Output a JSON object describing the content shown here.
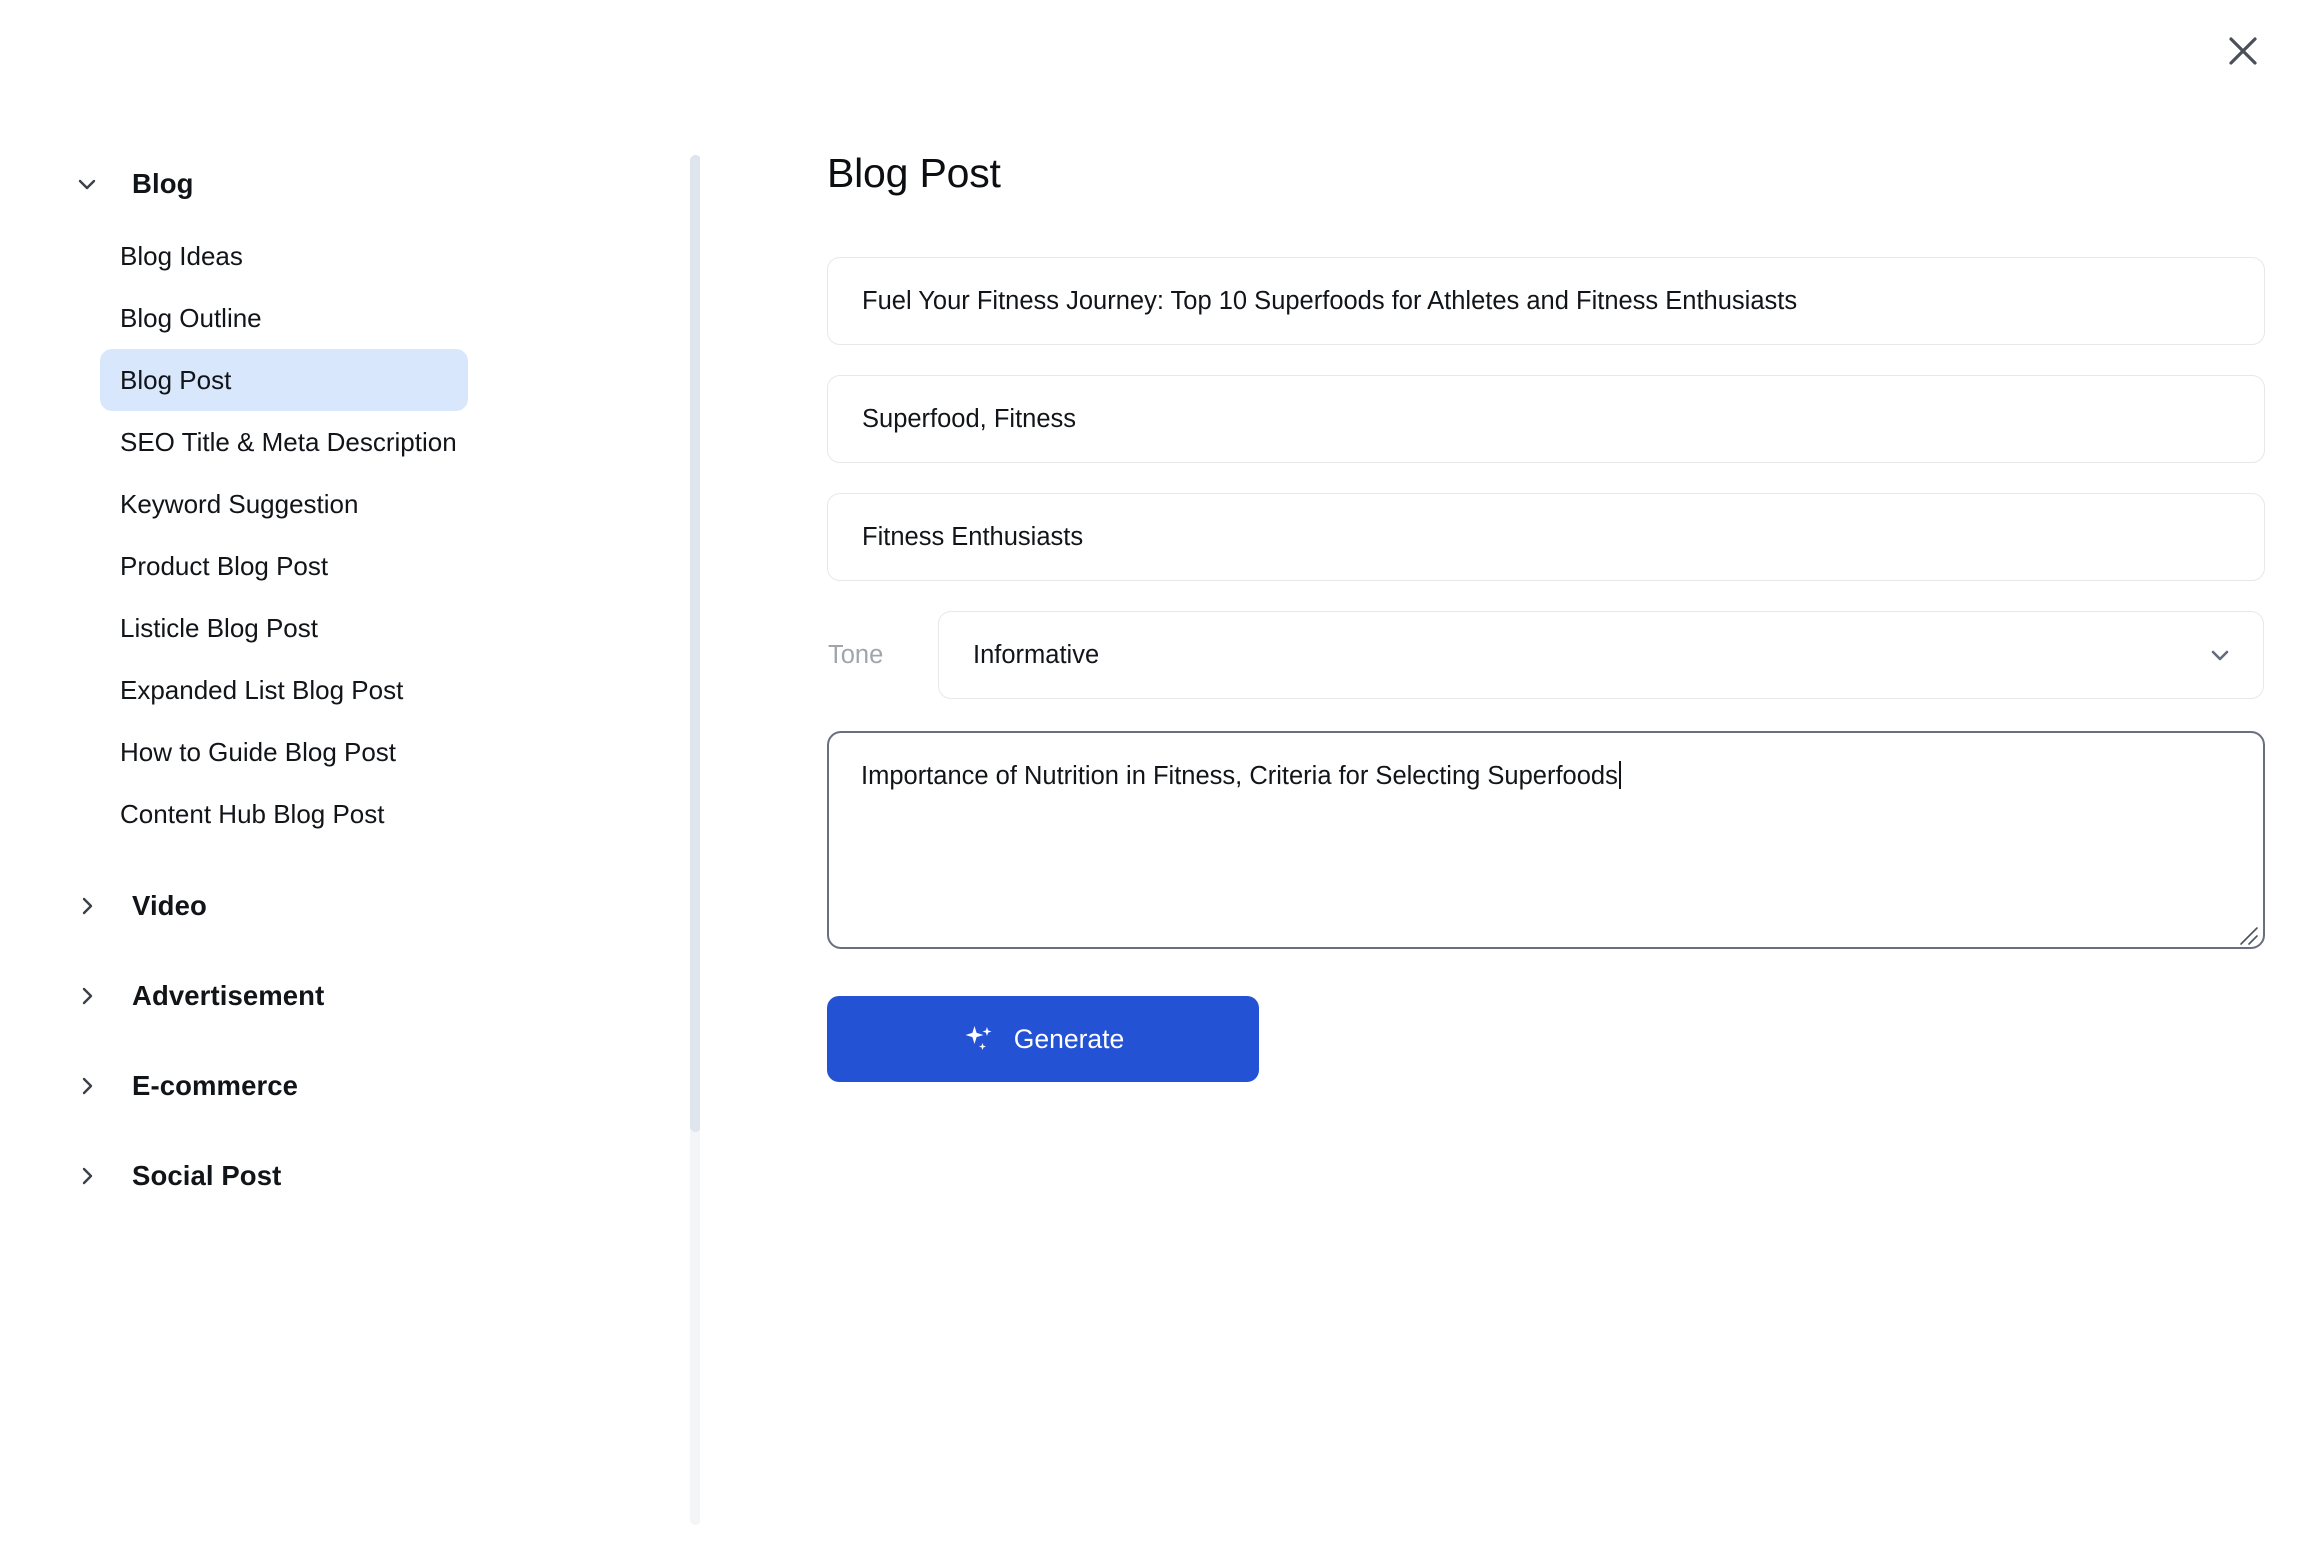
{
  "window": {
    "close_label": "Close"
  },
  "sidebar": {
    "groups": [
      {
        "label": "Blog",
        "expanded": true,
        "icon": "chevron-down-icon",
        "items": [
          {
            "label": "Blog Ideas",
            "selected": false
          },
          {
            "label": "Blog Outline",
            "selected": false
          },
          {
            "label": "Blog Post",
            "selected": true
          },
          {
            "label": "SEO Title & Meta Description",
            "selected": false
          },
          {
            "label": "Keyword Suggestion",
            "selected": false
          },
          {
            "label": "Product Blog Post",
            "selected": false
          },
          {
            "label": "Listicle Blog Post",
            "selected": false
          },
          {
            "label": "Expanded List Blog Post",
            "selected": false
          },
          {
            "label": "How to Guide Blog Post",
            "selected": false
          },
          {
            "label": "Content Hub Blog Post",
            "selected": false
          }
        ]
      },
      {
        "label": "Video",
        "expanded": false,
        "icon": "chevron-right-icon",
        "items": []
      },
      {
        "label": "Advertisement",
        "expanded": false,
        "icon": "chevron-right-icon",
        "items": []
      },
      {
        "label": "E-commerce",
        "expanded": false,
        "icon": "chevron-right-icon",
        "items": []
      },
      {
        "label": "Social Post",
        "expanded": false,
        "icon": "chevron-right-icon",
        "items": []
      }
    ]
  },
  "main": {
    "title": "Blog Post",
    "fields": {
      "topic": {
        "value": "Fuel Your Fitness Journey: Top 10 Superfoods for Athletes and Fitness Enthusiasts",
        "placeholder": "Blog title"
      },
      "keywords": {
        "value": "Superfood, Fitness",
        "placeholder": "Keywords"
      },
      "audience": {
        "value": "Fitness Enthusiasts",
        "placeholder": "Target audience"
      },
      "tone": {
        "label": "Tone",
        "value": "Informative",
        "options": [
          "Informative"
        ]
      },
      "outline": {
        "value": "Importance of Nutrition in Fitness, Criteria for Selecting Superfoods",
        "placeholder": "Outline"
      }
    },
    "generate_button": {
      "label": "Generate",
      "icon": "sparkle-icon",
      "color": "#2353d4"
    }
  },
  "colors": {
    "accent": "#2353d4",
    "selected_item_bg": "#d9e7fd",
    "field_border": "#e6e8ec",
    "focused_border": "#686f7e",
    "muted_text": "#a0a5ad",
    "scroll_thumb": "#dfe5ec",
    "scroll_track": "#f4f5f7"
  }
}
